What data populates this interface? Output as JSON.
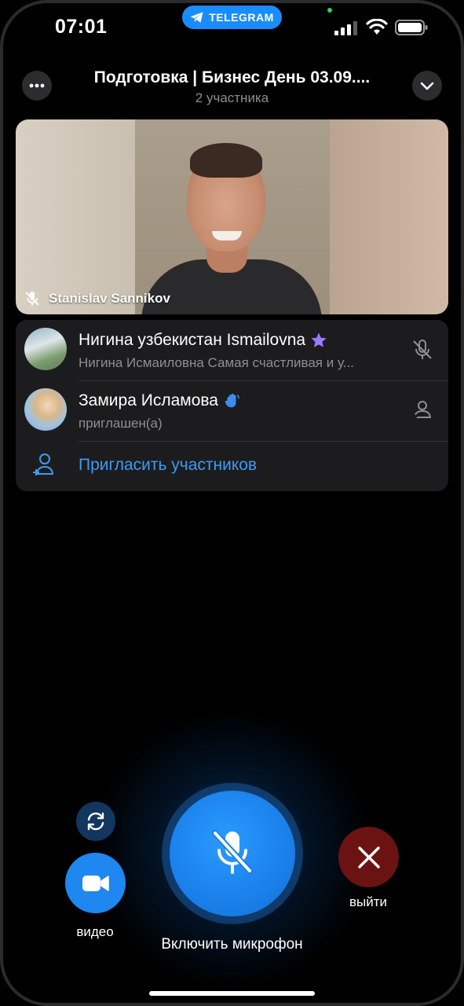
{
  "status_bar": {
    "time": "07:01",
    "app_pill": "TELEGRAM",
    "icons": [
      "signal-icon",
      "wifi-icon",
      "battery-icon"
    ]
  },
  "header": {
    "title": "Подготовка | Бизнес День 03.09....",
    "subtitle": "2 участника",
    "more_icon": "more-icon",
    "collapse_icon": "chevron-down-icon"
  },
  "video_tile": {
    "speaker_name": "Stanislav Sannikov",
    "mic_state_icon": "mic-muted-icon"
  },
  "participants": [
    {
      "name": "Нигина узбекистан Ismailovna",
      "badge_icon": "premium-star-icon",
      "status": "Нигина Исмаиловна Самая счастливая и у...",
      "action_icon": "mic-muted-icon"
    },
    {
      "name": "Замира Исламова",
      "badge_icon": "waving-hand-icon",
      "status": "приглашен(а)",
      "action_icon": "invited-user-icon"
    }
  ],
  "invite": {
    "label": "Пригласить участников",
    "icon": "add-user-icon"
  },
  "controls": {
    "flip_camera_icon": "flip-camera-icon",
    "video_label": "видео",
    "mic_label": "Включить микрофон",
    "leave_label": "выйти"
  },
  "colors": {
    "accent": "#1e87f0",
    "link": "#3d9bf2",
    "leave": "#6b1313",
    "panel": "#1c1c1e",
    "secondary_text": "#8e8e93"
  }
}
